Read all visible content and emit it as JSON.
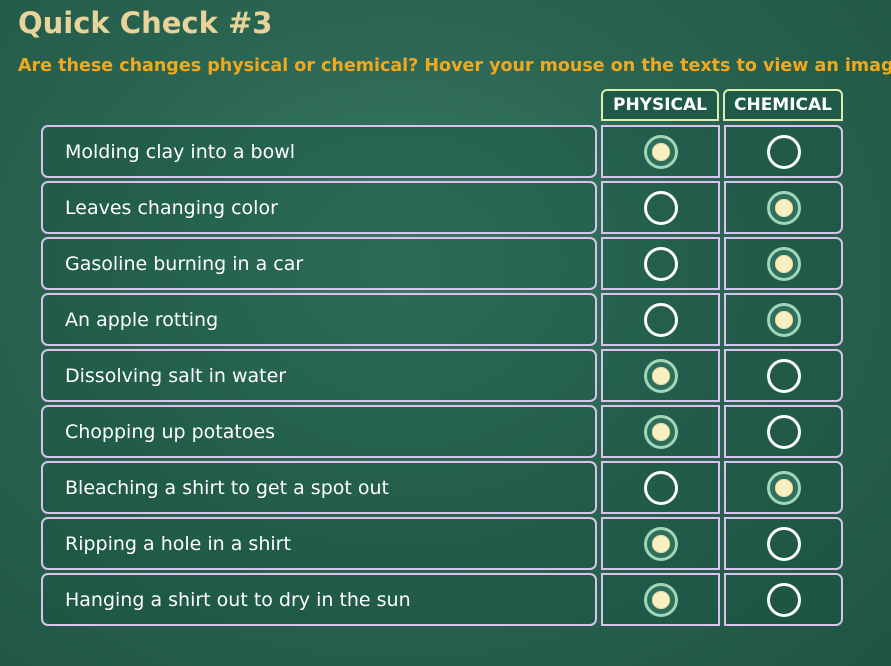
{
  "quiz": {
    "title": "Quick Check #3",
    "instructions": "Are these changes physical or chemical? Hover your mouse on the texts to view an image.",
    "columns": {
      "physical": "PHYSICAL",
      "chemical": "CHEMICAL"
    },
    "items": [
      {
        "label": "Molding clay into a bowl",
        "selected": "physical"
      },
      {
        "label": "Leaves changing color",
        "selected": "chemical"
      },
      {
        "label": "Gasoline burning in a car",
        "selected": "chemical"
      },
      {
        "label": "An apple rotting",
        "selected": "chemical"
      },
      {
        "label": "Dissolving salt in water",
        "selected": "physical"
      },
      {
        "label": "Chopping up potatoes",
        "selected": "physical"
      },
      {
        "label": "Bleaching a shirt to get a spot out",
        "selected": "chemical"
      },
      {
        "label": "Ripping a hole in a shirt",
        "selected": "physical"
      },
      {
        "label": "Hanging a shirt out to dry in the sun",
        "selected": "physical"
      }
    ]
  },
  "colors": {
    "background": "#2a6552",
    "title": "#e8d39a",
    "instructions": "#f2a81d",
    "row_border": "#d9c2ec",
    "header_border": "#d8efb1"
  }
}
